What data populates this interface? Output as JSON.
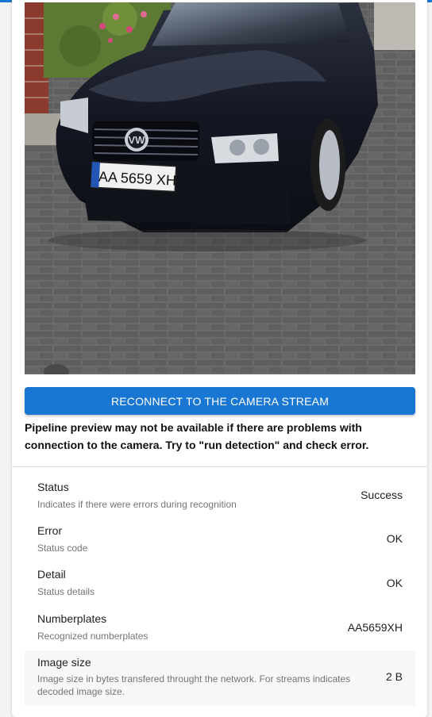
{
  "camera": {
    "image_alt": "Camera frame: black car with number plate",
    "plate_text": "AA 5659 XH",
    "reconnect_label": "RECONNECT TO THE CAMERA STREAM",
    "hint": "Pipeline preview may not be available if there are problems with connection to the camera. Try to \"run detection\" and check error."
  },
  "results": [
    {
      "label": "Status",
      "description": "Indicates if there were errors during recognition",
      "value": "Success"
    },
    {
      "label": "Error",
      "description": "Status code",
      "value": "OK"
    },
    {
      "label": "Detail",
      "description": "Status details",
      "value": "OK"
    },
    {
      "label": "Numberplates",
      "description": "Recognized numberplates",
      "value": "AA5659XH"
    },
    {
      "label": "Image size",
      "description": "Image size in bytes transfered throught the network. For streams indicates decoded image size.",
      "value": "2 B"
    }
  ],
  "colors": {
    "primary": "#1976d2"
  }
}
